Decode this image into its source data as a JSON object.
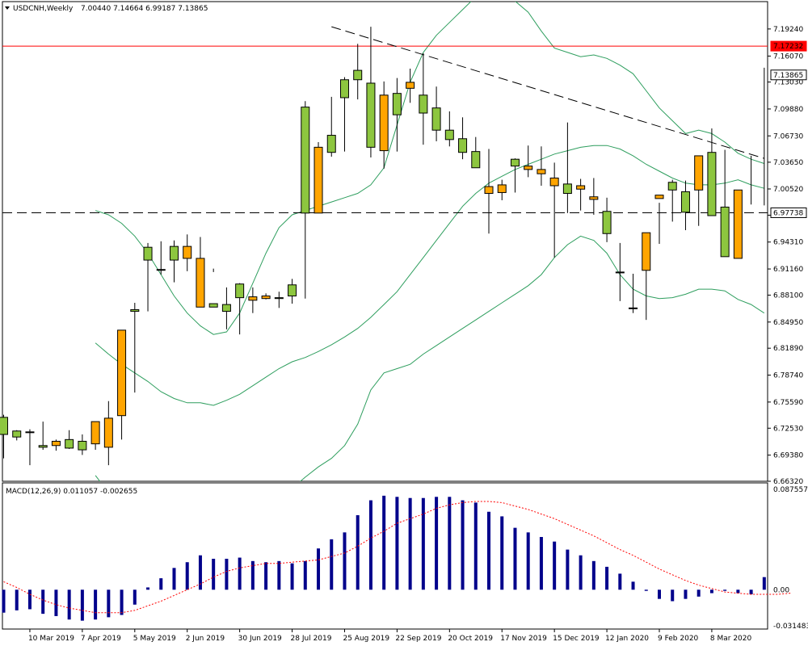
{
  "chart_data": [
    {
      "type": "candlestick",
      "symbol": "USDCNH",
      "timeframe": "Weekly",
      "header": {
        "title": "USDCNH,Weekly",
        "ohlc": "7.00440 7.14664 6.99187 7.13865"
      },
      "colors": {
        "bull": "#8dc63f",
        "bear": "#ffa500",
        "wick": "#000000",
        "bands": "#2e9e5e",
        "hline": "#ff0000",
        "frame": "#000000"
      },
      "ylim": [
        6.6632,
        7.2244
      ],
      "ytick_labels": [
        "7.19240",
        "7.16070",
        "7.13030",
        "7.09880",
        "7.06730",
        "7.03650",
        "7.00520",
        "6.97450",
        "6.94310",
        "6.91160",
        "6.88100",
        "6.84950",
        "6.81890",
        "6.78740",
        "6.75590",
        "6.72530",
        "6.69380",
        "6.66320"
      ],
      "x_labels": [
        "10 Mar 2019",
        "7 Apr 2019",
        "5 May 2019",
        "2 Jun 2019",
        "30 Jun 2019",
        "28 Jul 2019",
        "25 Aug 2019",
        "22 Sep 2019",
        "20 Oct 2019",
        "17 Nov 2019",
        "15 Dec 2019",
        "12 Jan 2020",
        "9 Feb 2020",
        "8 Mar 2020"
      ],
      "horizontal_lines": [
        {
          "value": 7.17232,
          "label": "7.17232",
          "style": "solid"
        },
        {
          "value": 6.97738,
          "label": "6.97738",
          "style": "dashed"
        }
      ],
      "price_marker": {
        "value": 7.13865,
        "label": "7.13865"
      },
      "trendline": {
        "from": {
          "week": 25,
          "price": 7.195
        },
        "to": {
          "week": 57,
          "price": 7.041
        }
      },
      "weeks": [
        "2019-02-24",
        "2019-03-03",
        "2019-03-10",
        "2019-03-17",
        "2019-03-24",
        "2019-03-31",
        "2019-04-07",
        "2019-04-14",
        "2019-04-21",
        "2019-04-28",
        "2019-05-05",
        "2019-05-12",
        "2019-05-19",
        "2019-05-26",
        "2019-06-02",
        "2019-06-09",
        "2019-06-16",
        "2019-06-23",
        "2019-06-30",
        "2019-07-07",
        "2019-07-14",
        "2019-07-21",
        "2019-07-28",
        "2019-08-04",
        "2019-08-11",
        "2019-08-18",
        "2019-08-25",
        "2019-09-01",
        "2019-09-08",
        "2019-09-15",
        "2019-09-22",
        "2019-09-29",
        "2019-10-06",
        "2019-10-13",
        "2019-10-20",
        "2019-10-27",
        "2019-11-03",
        "2019-11-10",
        "2019-11-17",
        "2019-11-24",
        "2019-12-01",
        "2019-12-08",
        "2019-12-15",
        "2019-12-22",
        "2019-12-29",
        "2020-01-05",
        "2020-01-12",
        "2020-01-19",
        "2020-01-26",
        "2020-02-02",
        "2020-02-09",
        "2020-02-16",
        "2020-02-23",
        "2020-03-01",
        "2020-03-08"
      ],
      "open": [
        6.718,
        6.715,
        6.721,
        6.703,
        6.71,
        6.702,
        6.7,
        6.733,
        6.737,
        6.84,
        6.862,
        6.922,
        6.911,
        6.922,
        6.938,
        6.924,
        6.867,
        6.862,
        6.878,
        6.879,
        6.88,
        6.877,
        6.88,
        6.977,
        7.054,
        7.048,
        7.112,
        7.133,
        7.054,
        7.115,
        7.092,
        7.13,
        7.094,
        7.074,
        7.063,
        7.048,
        7.03,
        7.008,
        7.01,
        7.032,
        7.032,
        7.028,
        7.018,
        7.0,
        7.009,
        6.996,
        6.953,
        6.908,
        6.866,
        6.954,
        6.998,
        7.004,
        6.978,
        7.044,
        6.974,
        6.926,
        7.004
      ],
      "close": [
        6.738,
        6.722,
        6.721,
        6.705,
        6.705,
        6.712,
        6.71,
        6.707,
        6.703,
        6.74,
        6.864,
        6.937,
        6.911,
        6.938,
        6.924,
        6.867,
        6.871,
        6.87,
        6.894,
        6.875,
        6.877,
        6.878,
        6.893,
        7.101,
        6.977,
        7.068,
        7.133,
        7.144,
        7.129,
        7.05,
        7.117,
        7.123,
        7.115,
        7.1,
        7.074,
        7.064,
        7.049,
        7.0,
        7.001,
        7.04,
        7.028,
        7.023,
        7.009,
        7.011,
        7.005,
        6.993,
        6.979,
        6.908,
        6.866,
        6.91,
        6.994,
        7.013,
        7.002,
        7.004,
        7.048,
        6.984,
        6.924,
        7.024,
        7.139
      ],
      "high": [
        6.741,
        6.723,
        6.724,
        6.733,
        6.712,
        6.723,
        6.718,
        6.725,
        6.757,
        6.748,
        6.872,
        6.942,
        6.944,
        6.945,
        6.952,
        6.949,
        6.912,
        6.89,
        6.895,
        6.89,
        6.883,
        6.885,
        6.9,
        7.108,
        7.06,
        7.113,
        7.136,
        7.175,
        7.195,
        7.131,
        7.135,
        7.146,
        7.164,
        7.125,
        7.096,
        7.089,
        7.066,
        7.052,
        7.016,
        7.041,
        7.056,
        7.055,
        7.036,
        7.083,
        7.017,
        7.018,
        6.995,
        6.942,
        6.906,
        6.951,
        6.989,
        7.016,
        7.015,
        7.04,
        7.076,
        7.051,
        6.988,
        7.044,
        7.147
      ],
      "low": [
        6.69,
        6.711,
        6.682,
        6.7,
        6.699,
        6.701,
        6.694,
        6.7,
        6.682,
        6.712,
        6.767,
        6.862,
        6.905,
        6.896,
        6.909,
        6.918,
        6.908,
        6.841,
        6.835,
        6.86,
        6.876,
        6.866,
        6.871,
        6.877,
        6.982,
        7.043,
        7.049,
        7.11,
        7.042,
        7.029,
        7.049,
        7.106,
        7.057,
        7.061,
        7.055,
        7.04,
        7.032,
        6.953,
        6.992,
        7.001,
        7.019,
        7.009,
        6.925,
        6.977,
        6.98,
        6.975,
        6.943,
        6.874,
        6.86,
        6.852,
        6.941,
        6.967,
        6.957,
        6.962,
        6.977,
        6.977,
        6.927,
        6.987,
        6.986
      ],
      "bollinger": {
        "upper": [
          6.98,
          6.975,
          6.965,
          6.95,
          6.93,
          6.905,
          6.88,
          6.86,
          6.845,
          6.835,
          6.838,
          6.86,
          6.895,
          6.93,
          6.96,
          6.975,
          6.98,
          6.985,
          6.99,
          6.995,
          7.0,
          7.01,
          7.03,
          7.08,
          7.13,
          7.165,
          7.185,
          7.2,
          7.215,
          7.23,
          7.235,
          7.232,
          7.225,
          7.212,
          7.19,
          7.17,
          7.165,
          7.16,
          7.162,
          7.158,
          7.15,
          7.14,
          7.12,
          7.1,
          7.085,
          7.07,
          7.074,
          7.07,
          7.06,
          7.047,
          7.04,
          7.035
        ],
        "middle": [
          6.825,
          6.812,
          6.8,
          6.79,
          6.78,
          6.768,
          6.76,
          6.755,
          6.755,
          6.752,
          6.758,
          6.765,
          6.775,
          6.785,
          6.795,
          6.803,
          6.808,
          6.815,
          6.823,
          6.832,
          6.842,
          6.855,
          6.87,
          6.885,
          6.905,
          6.925,
          6.945,
          6.965,
          6.985,
          7.0,
          7.012,
          7.02,
          7.028,
          7.034,
          7.04,
          7.046,
          7.05,
          7.054,
          7.056,
          7.056,
          7.052,
          7.044,
          7.034,
          7.026,
          7.018,
          7.012,
          7.01,
          7.01,
          7.012,
          7.016,
          7.01,
          7.006
        ],
        "lower": [
          6.67,
          6.65,
          6.63,
          6.61,
          6.59,
          6.57,
          6.555,
          6.545,
          6.54,
          6.545,
          6.56,
          6.578,
          6.598,
          6.62,
          6.64,
          6.655,
          6.668,
          6.68,
          6.69,
          6.705,
          6.73,
          6.77,
          6.79,
          6.795,
          6.8,
          6.812,
          6.822,
          6.832,
          6.842,
          6.852,
          6.862,
          6.872,
          6.882,
          6.892,
          6.905,
          6.925,
          6.94,
          6.95,
          6.945,
          6.93,
          6.905,
          6.888,
          6.88,
          6.877,
          6.878,
          6.882,
          6.888,
          6.888,
          6.886,
          6.876,
          6.87,
          6.86
        ]
      }
    },
    {
      "type": "macd",
      "title": "MACD(12,26,9) 0.011057 -0.002655",
      "ylim": [
        -0.031483,
        0.087557
      ],
      "ytick_labels": [
        "0.087557",
        "0.00",
        "-0.031483"
      ],
      "colors": {
        "histogram": "#00008b",
        "signal": "#ff0000"
      },
      "histogram": [
        -0.02,
        -0.018,
        -0.017,
        -0.021,
        -0.023,
        -0.026,
        -0.027,
        -0.026,
        -0.024,
        -0.022,
        -0.013,
        0.002,
        0.01,
        0.019,
        0.024,
        0.03,
        0.027,
        0.027,
        0.028,
        0.025,
        0.024,
        0.025,
        0.023,
        0.025,
        0.036,
        0.044,
        0.05,
        0.065,
        0.078,
        0.082,
        0.081,
        0.08,
        0.08,
        0.081,
        0.081,
        0.078,
        0.076,
        0.068,
        0.064,
        0.054,
        0.05,
        0.046,
        0.042,
        0.035,
        0.03,
        0.025,
        0.02,
        0.014,
        0.007,
        -0.001,
        -0.008,
        -0.01,
        -0.008,
        -0.006,
        -0.003,
        -0.001,
        -0.003,
        -0.004,
        0.011
      ],
      "signal": [
        0.007,
        0.002,
        -0.004,
        -0.009,
        -0.013,
        -0.016,
        -0.018,
        -0.02,
        -0.02,
        -0.02,
        -0.018,
        -0.014,
        -0.01,
        -0.005,
        0.0,
        0.005,
        0.011,
        0.016,
        0.019,
        0.021,
        0.023,
        0.023,
        0.024,
        0.025,
        0.026,
        0.029,
        0.032,
        0.038,
        0.045,
        0.051,
        0.058,
        0.062,
        0.066,
        0.071,
        0.074,
        0.076,
        0.077,
        0.077,
        0.076,
        0.073,
        0.07,
        0.066,
        0.062,
        0.057,
        0.052,
        0.047,
        0.041,
        0.035,
        0.03,
        0.024,
        0.018,
        0.013,
        0.008,
        0.004,
        0.001,
        -0.002,
        -0.003,
        -0.004,
        -0.004,
        -0.004,
        -0.003
      ]
    }
  ]
}
